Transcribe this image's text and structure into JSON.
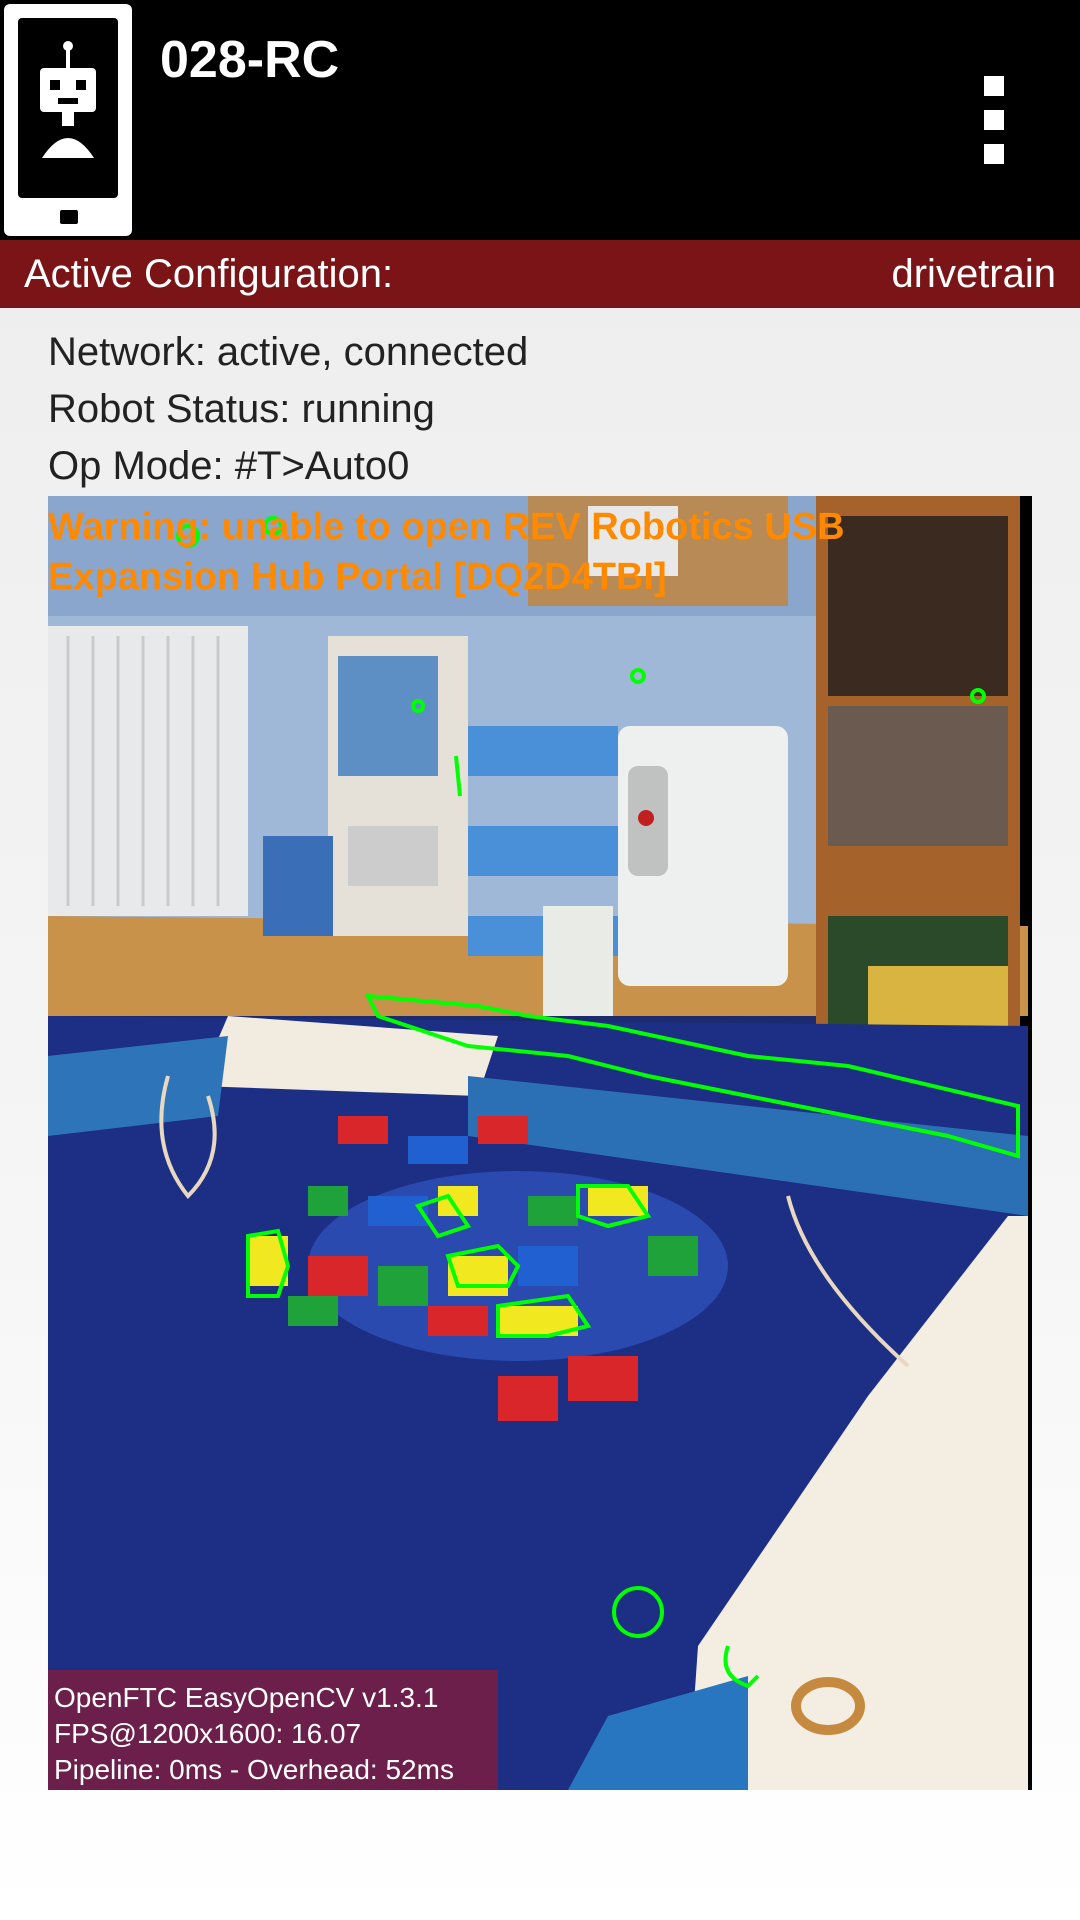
{
  "app": {
    "title": "028-RC",
    "icon": "robot-phone-icon",
    "menu_icon": "overflow-menu-icon"
  },
  "config": {
    "label": "Active Configuration:",
    "value": "drivetrain",
    "bar_color": "#7b1416"
  },
  "status": {
    "network": "Network: active, connected",
    "robot": "Robot Status: running",
    "op_mode": "Op Mode: #T>Auto0"
  },
  "camera": {
    "warning_line1": "Warning: unable to open REV Robotics USB",
    "warning_line2": "Expansion Hub Portal [DQ2D4TBI]",
    "warning_color": "#ff8a00",
    "contour_color": "#00ff00",
    "info_line1": "OpenFTC EasyOpenCV v1.3.1",
    "info_line2": "FPS@1200x1600: 16.07",
    "info_line3": "Pipeline: 0ms - Overhead: 52ms"
  }
}
